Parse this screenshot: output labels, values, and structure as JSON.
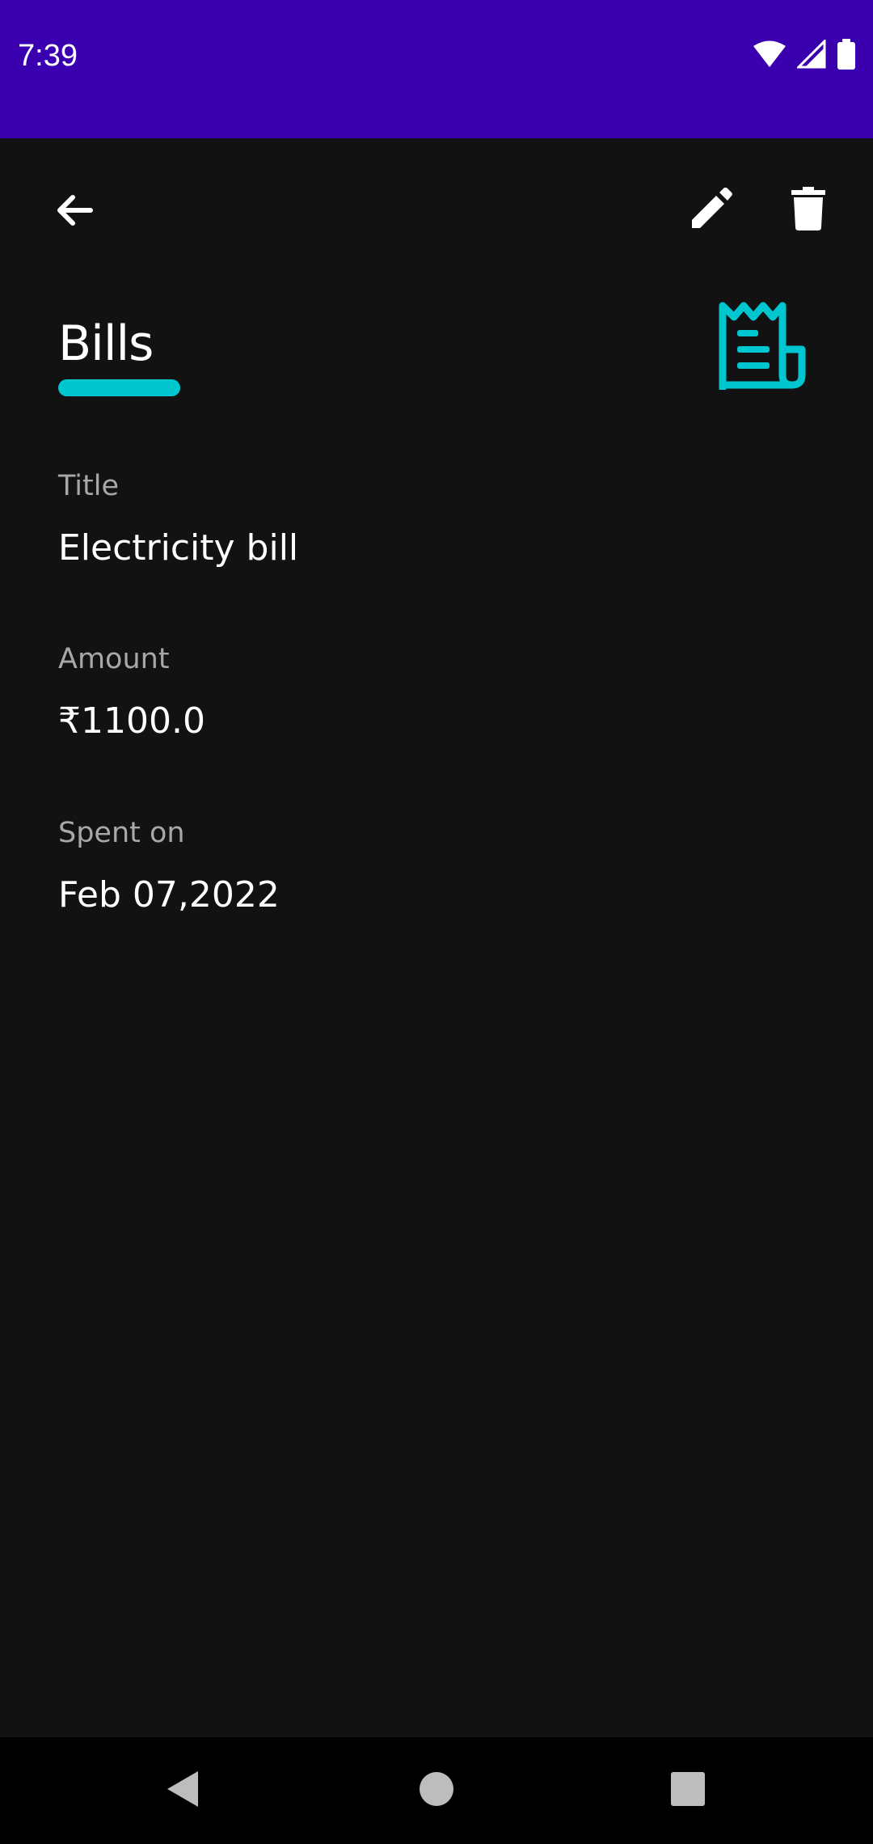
{
  "status_bar": {
    "time": "7:39",
    "icons": [
      "wifi-icon",
      "cellular-signal-icon",
      "battery-icon"
    ]
  },
  "toolbar": {
    "back_icon": "arrow-left-icon",
    "edit_icon": "pencil-icon",
    "delete_icon": "trash-icon"
  },
  "category": {
    "name": "Bills",
    "icon": "receipt-icon",
    "accent_color": "#00C6CF"
  },
  "details": {
    "title_label": "Title",
    "title_value": "Electricity bill",
    "amount_label": "Amount",
    "amount_value": "₹1100.0",
    "spent_label": "Spent on",
    "spent_value": "Feb 07,2022"
  },
  "nav_bar": {
    "icons": [
      "nav-back-icon",
      "nav-home-icon",
      "nav-recents-icon"
    ]
  },
  "colors": {
    "status_bar_bg": "#3A00B0",
    "background": "#121212",
    "label_text": "#A8A8A8",
    "value_text": "#FFFFFF",
    "nav_bar_bg": "#000000"
  }
}
